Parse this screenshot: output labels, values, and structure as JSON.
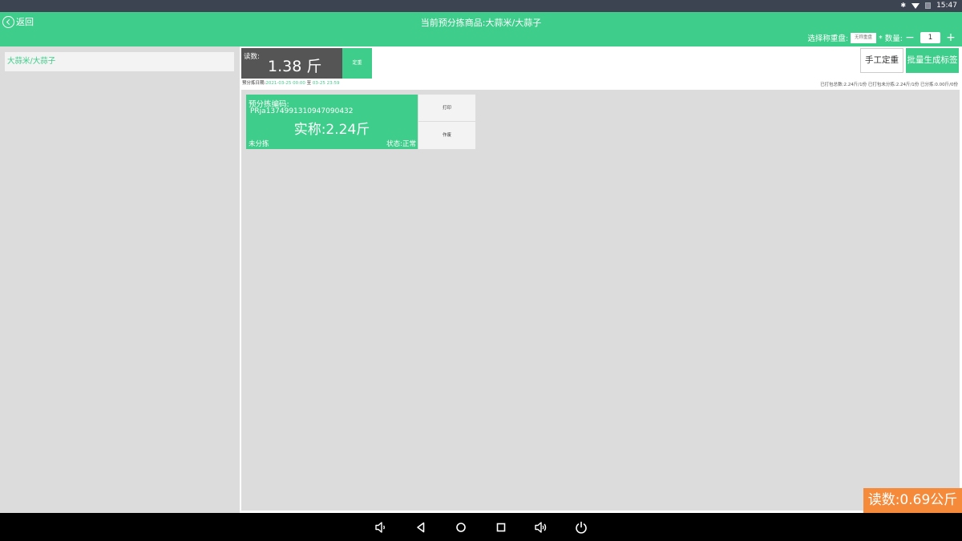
{
  "status_bar": {
    "time": "15:47",
    "icons": [
      "bluetooth-icon",
      "wifi-icon",
      "sim-icon"
    ]
  },
  "header": {
    "back_label": "返回",
    "title": "当前预分拣商品:大蒜米/大蒜子",
    "scale_label": "选择称重盘:",
    "scale_value": "无称重盘",
    "qty_label": "* 数量:",
    "qty_minus": "−",
    "qty_value": "1",
    "qty_plus": "+"
  },
  "sidebar": {
    "items": [
      {
        "label": "大蒜米/大蒜子"
      }
    ]
  },
  "reading": {
    "label": "读数:",
    "value": "1.38 斤",
    "tare_label": "定重"
  },
  "date_range": {
    "prefix": "预分拣日期:",
    "start": "2021-03-25 00:00",
    "sep": " 至 ",
    "end": "03-25 23:59"
  },
  "actions": {
    "manual_label": "手工定重",
    "batch_label": "批量生成标签"
  },
  "stats": "已打包总数:2.24斤/1份 已打包未分拣:2.24斤/1份 已分拣:0.00斤/0份",
  "cards": [
    {
      "code_label": "预分拣编码:",
      "code": "PRja1374991310947090432",
      "weight": "实称:2.24斤",
      "sort_state": "未分拣",
      "status": "状态:正常",
      "print_label": "打印",
      "void_label": "作废"
    }
  ],
  "reading_badge": "读数:0.69公斤",
  "colors": {
    "accent": "#3ecd8a",
    "badge": "#f58a3a",
    "reading_bg": "#555555"
  }
}
